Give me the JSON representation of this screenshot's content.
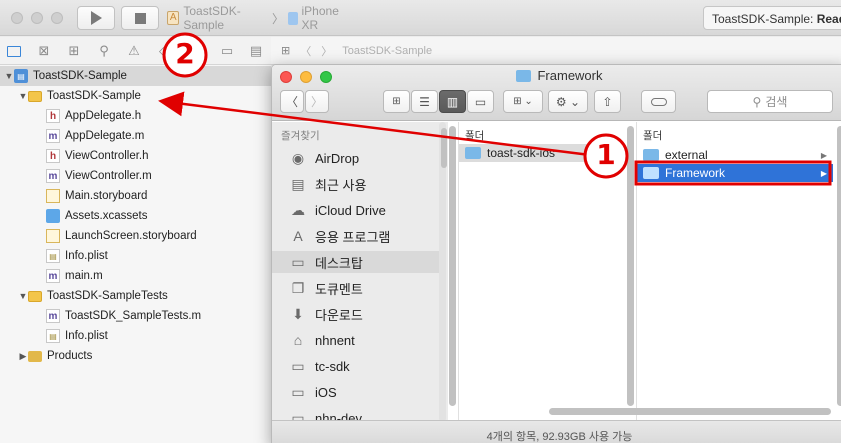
{
  "xcode": {
    "scheme": {
      "project": "ToastSDK-Sample",
      "device": "iPhone XR"
    },
    "status": {
      "prefix": "ToastSDK-Sample: ",
      "state": "Ready"
    },
    "editor_breadcrumb": "ToastSDK-Sample",
    "navigator": [
      {
        "label": "ToastSDK-Sample",
        "type": "project",
        "depth": 0,
        "disclosure": "open",
        "selected": true
      },
      {
        "label": "ToastSDK-Sample",
        "type": "folder",
        "depth": 1,
        "disclosure": "open"
      },
      {
        "label": "AppDelegate.h",
        "type": "h",
        "depth": 2
      },
      {
        "label": "AppDelegate.m",
        "type": "m",
        "depth": 2
      },
      {
        "label": "ViewController.h",
        "type": "h",
        "depth": 2
      },
      {
        "label": "ViewController.m",
        "type": "m",
        "depth": 2
      },
      {
        "label": "Main.storyboard",
        "type": "storyboard",
        "depth": 2
      },
      {
        "label": "Assets.xcassets",
        "type": "xcassets",
        "depth": 2
      },
      {
        "label": "LaunchScreen.storyboard",
        "type": "storyboard",
        "depth": 2
      },
      {
        "label": "Info.plist",
        "type": "plist",
        "depth": 2
      },
      {
        "label": "main.m",
        "type": "m",
        "depth": 2
      },
      {
        "label": "ToastSDK-SampleTests",
        "type": "folder",
        "depth": 1,
        "disclosure": "open"
      },
      {
        "label": "ToastSDK_SampleTests.m",
        "type": "m",
        "depth": 2
      },
      {
        "label": "Info.plist",
        "type": "plist",
        "depth": 2
      },
      {
        "label": "Products",
        "type": "products",
        "depth": 1,
        "disclosure": "closed"
      }
    ]
  },
  "finder": {
    "title": "Framework",
    "search_placeholder": "검색",
    "sidebar_header": "즐겨찾기",
    "sidebar": [
      {
        "label": "AirDrop",
        "icon": "airdrop-icon",
        "glyph": "◉"
      },
      {
        "label": "최근 사용",
        "icon": "recents-icon",
        "glyph": "▤"
      },
      {
        "label": "iCloud Drive",
        "icon": "cloud-icon",
        "glyph": "☁"
      },
      {
        "label": "응용 프로그램",
        "icon": "applications-icon",
        "glyph": "A"
      },
      {
        "label": "데스크탑",
        "icon": "desktop-icon",
        "glyph": "▭",
        "selected": true
      },
      {
        "label": "도큐멘트",
        "icon": "documents-icon",
        "glyph": "❐"
      },
      {
        "label": "다운로드",
        "icon": "downloads-icon",
        "glyph": "⬇"
      },
      {
        "label": "nhnent",
        "icon": "home-icon",
        "glyph": "⌂"
      },
      {
        "label": "tc-sdk",
        "icon": "folder-icon",
        "glyph": "▭"
      },
      {
        "label": "iOS",
        "icon": "folder-icon",
        "glyph": "▭"
      },
      {
        "label": "nhn-dev",
        "icon": "folder-icon",
        "glyph": "▭"
      }
    ],
    "columns": [
      {
        "header": "폴더",
        "items": [
          {
            "label": "toast-sdk-ios",
            "state": "dim-selected"
          }
        ]
      },
      {
        "header": "폴더",
        "items": [
          {
            "label": "external",
            "state": "normal"
          },
          {
            "label": "Framework",
            "state": "selected"
          }
        ]
      }
    ],
    "status_bar": "4개의 항목, 92.93GB 사용 가능"
  },
  "annotations": [
    {
      "label": "1",
      "color": "#e00000"
    },
    {
      "label": "2",
      "color": "#e00000"
    }
  ],
  "colors": {
    "selection": "#2f73d8",
    "annotation": "#e00000",
    "folder": "#f3c54a"
  }
}
